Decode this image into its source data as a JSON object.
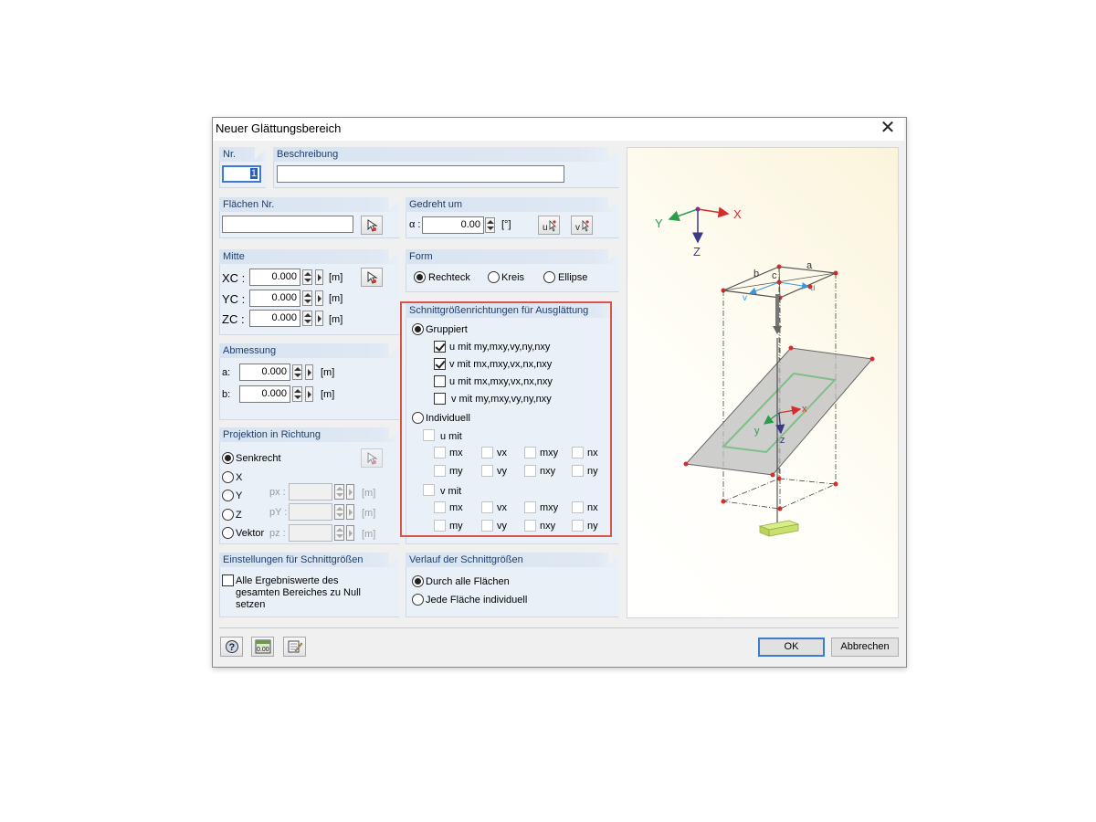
{
  "window": {
    "title": "Neuer Glättungsbereich",
    "close": "✕"
  },
  "nr": {
    "label": "Nr.",
    "value": "1"
  },
  "beschreibung": {
    "label": "Beschreibung",
    "value": ""
  },
  "flaechen": {
    "label": "Flächen Nr.",
    "value": ""
  },
  "gedreht": {
    "label": "Gedreht um",
    "alpha": "α :",
    "value": "0.00",
    "unit": "[°]",
    "btn_u": "u",
    "btn_v": "v"
  },
  "mitte": {
    "label": "Mitte",
    "rows": [
      {
        "label": "XC :",
        "value": "0.000",
        "unit": "[m]"
      },
      {
        "label": "YC :",
        "value": "0.000",
        "unit": "[m]"
      },
      {
        "label": "ZC :",
        "value": "0.000",
        "unit": "[m]"
      }
    ]
  },
  "form": {
    "label": "Form",
    "options": [
      "Rechteck",
      "Kreis",
      "Ellipse"
    ],
    "selected": "Rechteck"
  },
  "abmessung": {
    "label": "Abmessung",
    "rows": [
      {
        "label": "a:",
        "value": "0.000",
        "unit": "[m]"
      },
      {
        "label": "b:",
        "value": "0.000",
        "unit": "[m]"
      }
    ]
  },
  "schnitt": {
    "label": "Schnittgrößenrichtungen für Ausglättung",
    "gruppiert": "Gruppiert",
    "individuell": "Individuell",
    "group_options": [
      {
        "prefix": "u mit ",
        "text": "my,mxy,vy,ny,nxy",
        "checked": true
      },
      {
        "prefix": "v mit ",
        "text": "mx,mxy,vx,nx,nxy",
        "checked": true
      },
      {
        "prefix": "u mit ",
        "text": "mx,mxy,vx,nx,nxy",
        "checked": false
      },
      {
        "prefix": "v mit ",
        "text": "my,mxy,vy,ny,nxy",
        "checked": false
      }
    ],
    "u_mit": "u mit",
    "v_mit": "v mit",
    "row1": [
      "mx",
      "vx",
      "mxy",
      "nx"
    ],
    "row2": [
      "my",
      "vy",
      "nxy",
      "ny"
    ]
  },
  "projektion": {
    "label": "Projektion in Richtung",
    "options": [
      "Senkrecht",
      "X",
      "Y",
      "Z",
      "Vektor"
    ],
    "selected": "Senkrecht",
    "vec": [
      {
        "label": "px :",
        "unit": "[m]"
      },
      {
        "label": "pY :",
        "unit": "[m]"
      },
      {
        "label": "pz :",
        "unit": "[m]"
      }
    ]
  },
  "einstellungen": {
    "label": "Einstellungen für Schnittgrößen",
    "text1": "Alle Ergebniswerte des",
    "text2": "gesamten Bereiches zu Null",
    "text3": "setzen"
  },
  "verlauf": {
    "label": "Verlauf der Schnittgrößen",
    "options": [
      "Durch alle Flächen",
      "Jede Fläche individuell"
    ],
    "selected": "Durch alle Flächen"
  },
  "buttons": {
    "ok": "OK",
    "cancel": "Abbrechen",
    "units_icon_text": "0.00"
  },
  "preview": {
    "axis_x": "X",
    "axis_y": "Y",
    "axis_z": "Z",
    "label_a": "a",
    "label_b": "b",
    "label_c": "c",
    "label_u": "u",
    "label_v": "v",
    "local_x": "x",
    "local_y": "y",
    "local_z": "z"
  },
  "colors": {
    "header_text": "#1f3d6b",
    "group_bg": "#e9f0f8",
    "highlight": "#d9534f",
    "default_button": "#3b7bd4"
  }
}
